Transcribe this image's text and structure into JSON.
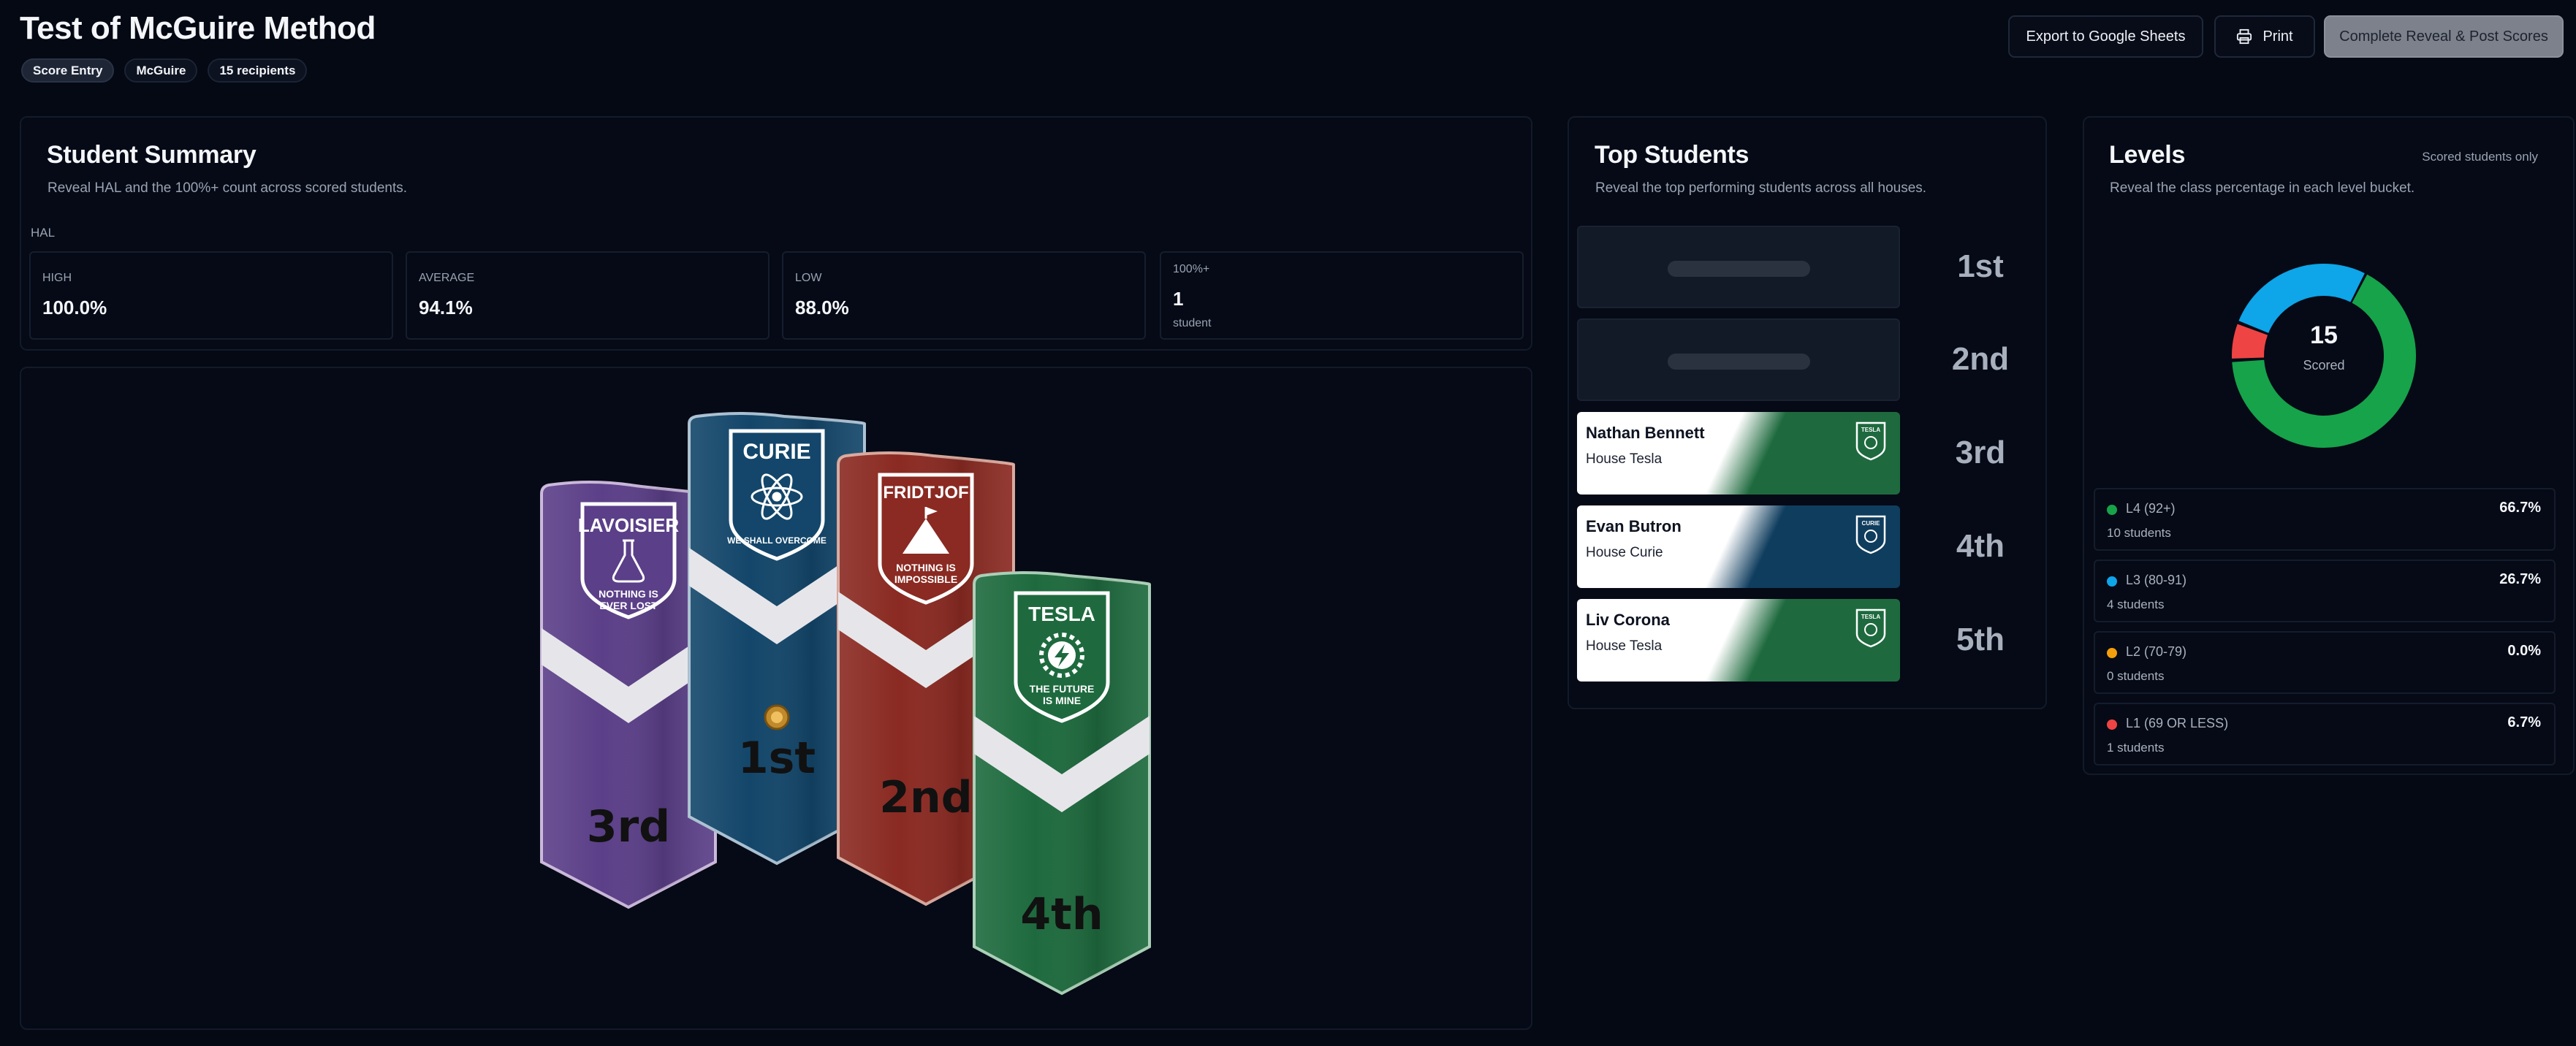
{
  "header": {
    "title": "Test of McGuire Method",
    "chips": [
      "Score Entry",
      "McGuire",
      "15 recipients"
    ],
    "export_label": "Export to Google Sheets",
    "print_label": "Print",
    "complete_label": "Complete Reveal & Post Scores"
  },
  "summary": {
    "title": "Student Summary",
    "subtitle": "Reveal HAL and the 100%+ count across scored students.",
    "hal_label": "HAL",
    "stats": [
      {
        "label": "HIGH",
        "value": "100.0%",
        "note": ""
      },
      {
        "label": "AVERAGE",
        "value": "94.1%",
        "note": ""
      },
      {
        "label": "LOW",
        "value": "88.0%",
        "note": ""
      },
      {
        "label": "100%+",
        "value": "1",
        "note": "student"
      }
    ]
  },
  "banners": [
    {
      "house": "LAVOISIER",
      "motto1": "NOTHING IS",
      "motto2": "EVER LOST",
      "place": "3rd",
      "color": "#5b3f88",
      "icon": "flask-icon"
    },
    {
      "house": "CURIE",
      "motto1": "WE SHALL OVERCOME",
      "motto2": "",
      "place": "1st",
      "color": "#13466a",
      "icon": "atom-icon"
    },
    {
      "house": "FRIDTJOF",
      "motto1": "NOTHING IS",
      "motto2": "IMPOSSIBLE",
      "place": "2nd",
      "color": "#8a2a22",
      "icon": "mountain-icon"
    },
    {
      "house": "TESLA",
      "motto1": "THE FUTURE",
      "motto2": "IS MINE",
      "place": "4th",
      "color": "#1e6a3e",
      "icon": "lightning-gear-icon"
    }
  ],
  "top_students": {
    "title": "Top Students",
    "subtitle": "Reveal the top performing students across all houses.",
    "ranks": [
      {
        "rank": "1st",
        "hidden": true,
        "name": "",
        "house": ""
      },
      {
        "rank": "2nd",
        "hidden": true,
        "name": "",
        "house": ""
      },
      {
        "rank": "3rd",
        "hidden": false,
        "name": "Nathan Bennett",
        "house": "House Tesla",
        "color": "#1e6a3e",
        "crest_text": "TESLA"
      },
      {
        "rank": "4th",
        "hidden": false,
        "name": "Evan Butron",
        "house": "House Curie",
        "color": "#0f3d5e",
        "crest_text": "CURIE"
      },
      {
        "rank": "5th",
        "hidden": false,
        "name": "Liv Corona",
        "house": "House Tesla",
        "color": "#1e6a3e",
        "crest_text": "TESLA"
      }
    ]
  },
  "levels": {
    "title": "Levels",
    "subtitle": "Reveal the class percentage in each level bucket.",
    "note": "Scored students only",
    "scored_count": "15",
    "scored_label": "Scored",
    "rows": [
      {
        "name": "L4 (92+)",
        "pct": "66.7%",
        "count": "10 students",
        "color": "#16a34a",
        "fraction": 0.667
      },
      {
        "name": "L3 (80-91)",
        "pct": "26.7%",
        "count": "4 students",
        "color": "#0ea5e9",
        "fraction": 0.267
      },
      {
        "name": "L2 (70-79)",
        "pct": "0.0%",
        "count": "0 students",
        "color": "#f59e0b",
        "fraction": 0.0
      },
      {
        "name": "L1 (69 OR LESS)",
        "pct": "6.7%",
        "count": "1 students",
        "color": "#ef4444",
        "fraction": 0.067
      }
    ]
  }
}
